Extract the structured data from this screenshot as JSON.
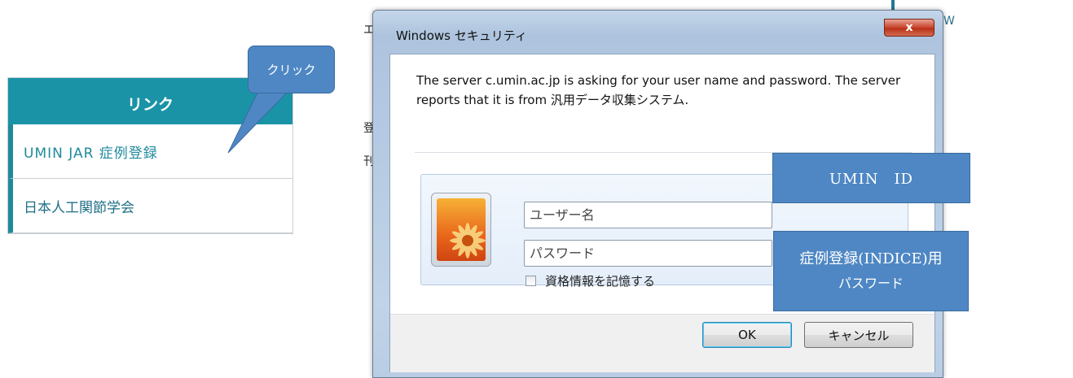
{
  "link_panel": {
    "header": "リンク",
    "items": [
      {
        "label": "UMIN JAR 症例登録"
      },
      {
        "label": "日本人工関節学会"
      }
    ]
  },
  "callouts": {
    "click": "クリック",
    "username": "UMIN　ID",
    "password_line1": "症例登録(INDICE)用",
    "password_line2": "パスワード"
  },
  "dialog": {
    "title": "Windows セキュリティ",
    "close_symbol": "x",
    "message": "The server c.umin.ac.jp is asking for your user name and password. The server reports that it is from 汎用データ収集システム.",
    "username_placeholder": "ユーザー名",
    "password_placeholder": "パスワード",
    "remember_label": "資格情報を記憶する",
    "ok_label": "OK",
    "cancel_label": "キャンセル"
  },
  "background_fragments": [
    "エ",
    "登",
    "刊",
    "W"
  ],
  "colors": {
    "teal_header": "#1a93a6",
    "link_text": "#1f8a9b",
    "callout_blue": "#4e87c4",
    "close_red": "#c8432a"
  },
  "icons": {
    "user_tile": "flower-avatar-icon"
  }
}
